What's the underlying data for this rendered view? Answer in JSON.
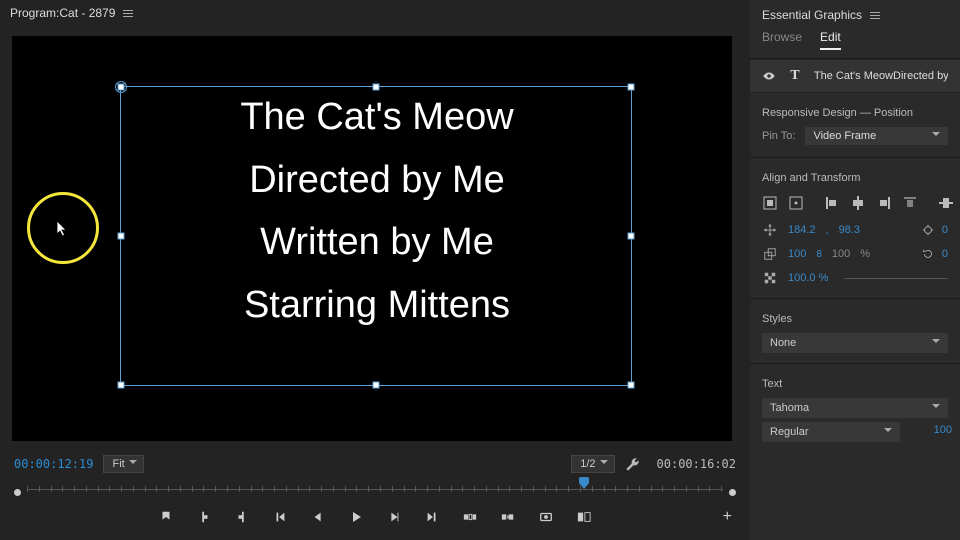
{
  "program": {
    "title_prefix": "Program: ",
    "title_name": "Cat - 2879"
  },
  "canvas": {
    "text_lines": [
      "The Cat's Meow",
      "Directed by Me",
      "Written by Me",
      "Starring Mittens"
    ]
  },
  "timecode": {
    "current": "00:00:12:19",
    "duration": "00:00:16:02"
  },
  "monitor": {
    "zoom": "Fit",
    "resolution": "1/2"
  },
  "playhead_percent": 80,
  "essential_graphics": {
    "panel_title": "Essential Graphics",
    "tabs": {
      "browse": "Browse",
      "edit": "Edit"
    },
    "layer_label": "The Cat's MeowDirected by"
  },
  "responsive": {
    "section": "Responsive Design — Position",
    "pin_to_label": "Pin To:",
    "pin_to_value": "Video Frame"
  },
  "align_section": "Align and Transform",
  "transform": {
    "pos_x": "184.2",
    "pos_y": "98.3",
    "anchor_x": "0",
    "scale_w": "100",
    "scale_h": "100",
    "unit": "%",
    "rotation": "0",
    "opacity": "100.0 %"
  },
  "styles": {
    "section": "Styles",
    "value": "None"
  },
  "text": {
    "section": "Text",
    "font": "Tahoma",
    "weight": "Regular",
    "size": "100"
  }
}
